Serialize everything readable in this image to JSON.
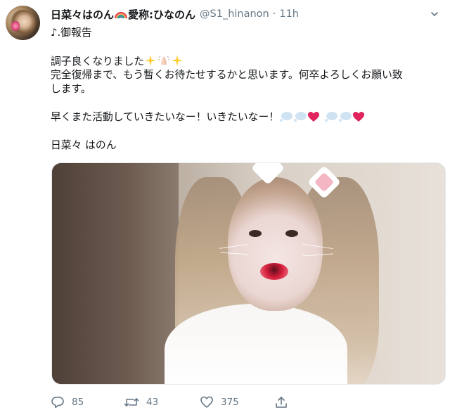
{
  "tweet": {
    "display_name_before": "日菜々はのん",
    "display_name_after": "愛称:ひなのん",
    "handle": "@S1_hinanon",
    "separator": "·",
    "time": "11h",
    "lines": [
      "♪.御報告",
      "",
      "調子良くなりました",
      "完全復帰まで、もう暫くお待たせするかと思います。何卒よろしくお願い致",
      "します。",
      "",
      "早くまた活動していきたいなー！いきたいなー！",
      "",
      "日菜々 はのん"
    ]
  },
  "actions": {
    "reply_count": "85",
    "retweet_count": "43",
    "like_count": "375"
  },
  "icons": {
    "reply": "reply-icon",
    "retweet": "retweet-icon",
    "like": "heart-icon",
    "share": "share-icon",
    "more": "chevron-down-icon"
  },
  "colors": {
    "text": "#14171a",
    "muted": "#657786",
    "border": "#e1e8ed",
    "heart": "#e0245e"
  }
}
